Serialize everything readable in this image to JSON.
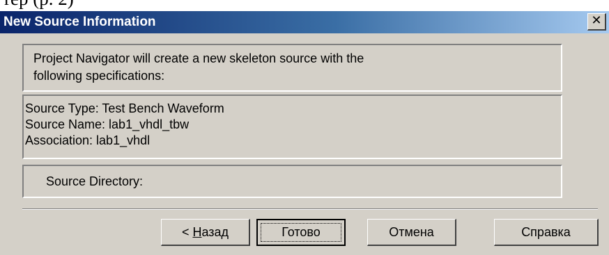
{
  "cropped_text": "rep (p. 2)",
  "window": {
    "title": "New Source Information",
    "close_glyph": "✕"
  },
  "intro": {
    "line1": "Project Navigator will create a new skeleton source with the",
    "line2": "following specifications:"
  },
  "spec": {
    "type_line": "Source Type:  Test Bench Waveform",
    "name_line": "Source Name:  lab1_vhdl_tbw",
    "association_line": "Association:  lab1_vhdl"
  },
  "directory": {
    "label": "Source Directory:"
  },
  "buttons": {
    "back_prefix": "< ",
    "back_mnemonic": "Н",
    "back_rest": "азад",
    "finish": "Готово",
    "cancel": "Отмена",
    "help": "Справка"
  },
  "colors": {
    "dialog_face": "#d4d0c8",
    "title_start": "#0a246a",
    "title_end": "#a6caf0",
    "title_text": "#ffffff"
  }
}
